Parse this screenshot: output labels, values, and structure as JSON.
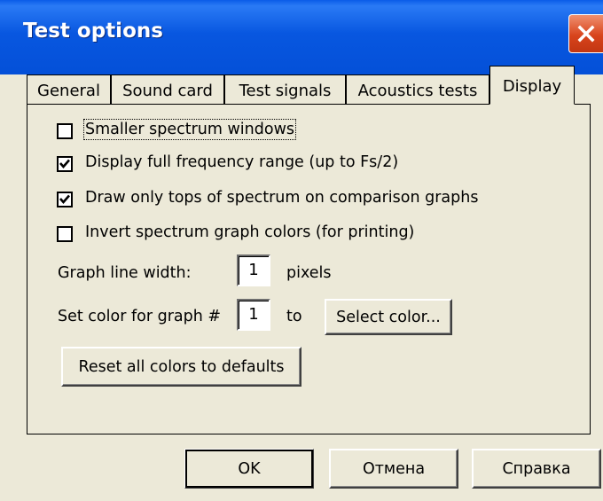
{
  "window": {
    "title": "Test options",
    "close_icon": "close-icon"
  },
  "tabs": [
    {
      "label": "General"
    },
    {
      "label": "Sound card"
    },
    {
      "label": "Test signals"
    },
    {
      "label": "Acoustics tests"
    },
    {
      "label": "Display",
      "active": true
    }
  ],
  "display": {
    "checkboxes": [
      {
        "label": "Smaller spectrum windows",
        "checked": false
      },
      {
        "label": "Display full frequency range (up to Fs/2)",
        "checked": true
      },
      {
        "label": "Draw only tops of spectrum on comparison graphs",
        "checked": true
      },
      {
        "label": "Invert spectrum graph colors (for printing)",
        "checked": false
      }
    ],
    "line_width": {
      "label": "Graph line width:",
      "value": "1",
      "unit": "pixels"
    },
    "graph_color": {
      "label": "Set color for graph #",
      "value": "1",
      "to": "to",
      "button": "Select color..."
    },
    "reset_button": "Reset all colors to defaults"
  },
  "buttons": {
    "ok": "OK",
    "cancel": "Отмена",
    "help": "Справка"
  }
}
